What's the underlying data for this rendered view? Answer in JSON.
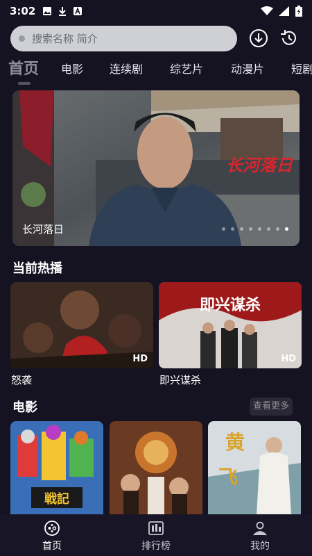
{
  "status_bar": {
    "time": "3:02",
    "left_icons": [
      "image-icon",
      "download-icon",
      "font-icon"
    ],
    "right_icons": [
      "wifi-icon",
      "signal-icon",
      "battery-icon"
    ]
  },
  "search": {
    "placeholder": "搜索名称 简介"
  },
  "header_icons": [
    "download-icon",
    "history-icon"
  ],
  "tabs": [
    {
      "label": "首页",
      "active": true
    },
    {
      "label": "电影",
      "active": false
    },
    {
      "label": "连续剧",
      "active": false
    },
    {
      "label": "综艺片",
      "active": false
    },
    {
      "label": "动漫片",
      "active": false
    },
    {
      "label": "短剧",
      "active": false
    }
  ],
  "banner": {
    "title": "长河落日",
    "logo_text": "长河落日",
    "slide_count": 8,
    "active_slide": 0
  },
  "hot": {
    "title": "当前热播",
    "items": [
      {
        "name": "怒袭",
        "badge": "HD"
      },
      {
        "name": "即兴谋杀",
        "badge": "HD"
      }
    ]
  },
  "movies": {
    "title": "电影",
    "more_label": "查看更多",
    "posters": [
      "poster-1",
      "poster-2",
      "poster-3"
    ]
  },
  "nav": [
    {
      "label": "首页",
      "icon": "gamepad-icon",
      "active": true
    },
    {
      "label": "排行榜",
      "icon": "ranking-icon",
      "active": false
    },
    {
      "label": "我的",
      "icon": "user-icon",
      "active": false
    }
  ],
  "colors": {
    "background": "#151221",
    "search_bg": "#cfcfd6",
    "nav_bg": "#181526",
    "accent_red": "#d8262b"
  }
}
